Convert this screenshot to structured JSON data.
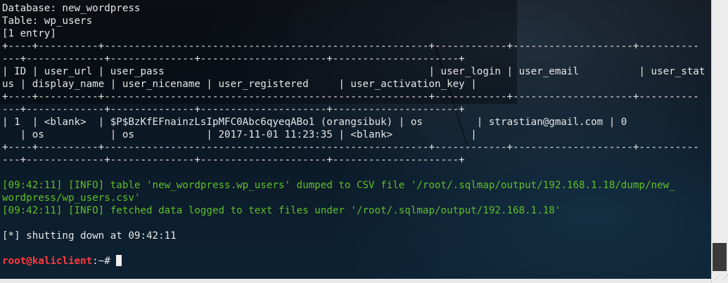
{
  "terminal": {
    "lines": [
      "Database: new_wordpress",
      "Table: wp_users",
      "[1 entry]",
      "+----+----------+------------------------------------------------------+------------+--------------------+----------",
      "---+-------------+--------------+---------------------+---------------------+",
      "| ID | user_url | user_pass                                            | user_login | user_email          | user_stat",
      "us | display_name | user_nicename | user_registered     | user_activation_key |",
      "+----+----------+------------------------------------------------------+------------+--------------------+----------",
      "---+-------------+--------------+---------------------+---------------------+",
      "| 1  | <blank>  | $P$BzKfEFnainzLsIpMFC0Abc6qyeqABo1 (orangsibuk) | os         | strastian@gmail.com | 0",
      "   | os           | os            | 2017-11-01 11:23:35 | <blank>             |",
      "+----+----------+------------------------------------------------------+------------+--------------------+----------",
      "---+-------------+--------------+---------------------+---------------------+",
      "",
      "[09:42:11] [INFO] table 'new_wordpress.wp_users' dumped to CSV file '/root/.sqlmap/output/192.168.1.18/dump/new_",
      "wordpress/wp_users.csv'",
      "[09:42:11] [INFO] fetched data logged to text files under '/root/.sqlmap/output/192.168.1.18'",
      "",
      "[*] shutting down at 09:42:11",
      ""
    ],
    "prompt_user": "root@kaliclient",
    "prompt_path": ":~# "
  },
  "colors": {
    "text": "#e6e6e6",
    "info": "#5fbf29",
    "prompt_user": "#ff3b3b",
    "background": "#0c1824"
  }
}
